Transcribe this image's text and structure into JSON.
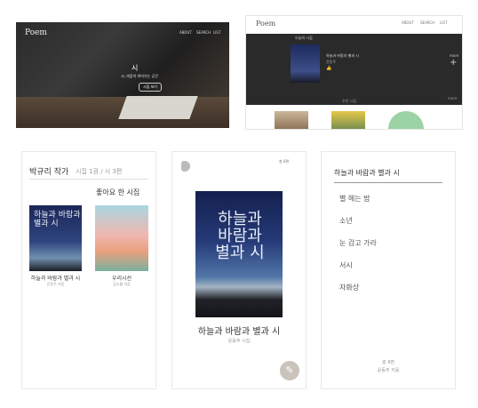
{
  "hero": {
    "logo": "Poem",
    "nav": [
      "ABOUT",
      "SEARCH",
      "LIST"
    ],
    "caption_main": "시",
    "caption_sub": "시, 마음이 쉬어가는 공간",
    "button": "시집 보기"
  },
  "top_right": {
    "logo": "Poem",
    "nav": [
      "ABOUT",
      "SEARCH",
      "LIST"
    ],
    "band_title": "오늘의 시집",
    "book_title": "하늘과 바람과 별과 시",
    "book_author": "윤동주",
    "like_icon": "thumbs-up-icon",
    "more_label": "more",
    "plus_icon": "plus-icon",
    "section_title": "추천 시집",
    "more_label_2": "more"
  },
  "author_panel": {
    "author": "박규리 작가",
    "meta": "시집 1권 / 시 3편",
    "liked_title": "좋아요 한 시집",
    "books": [
      {
        "cover_text": "하늘과 바람과 별과 시",
        "title": "하늘과 바람과 별과 시",
        "author": "윤동주 지음"
      },
      {
        "cover_text": "",
        "title": "우리시선",
        "author": "김소월 지음"
      }
    ]
  },
  "book_panel": {
    "back_icon": "back-icon",
    "count": "총 8편",
    "cover_text": "하늘과 바람과 별과 시",
    "title": "하늘과 바람과 별과 시",
    "author": "윤동주 시집",
    "fab_icon": "pencil-icon"
  },
  "list_panel": {
    "header": "하늘과 바람과 별과 시",
    "items": [
      "별 헤는 밤",
      "소년",
      "눈 감고 가라",
      "서시",
      "자화상"
    ],
    "total": "총 8편",
    "author": "윤동주 지음"
  }
}
